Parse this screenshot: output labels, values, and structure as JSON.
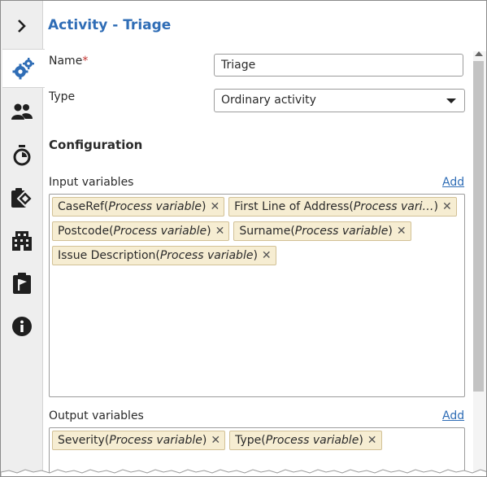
{
  "rail": {
    "items": [
      {
        "icon": "chevron-right-icon"
      },
      {
        "icon": "gears-icon",
        "active": true
      },
      {
        "icon": "people-icon"
      },
      {
        "icon": "stopwatch-icon"
      },
      {
        "icon": "clipboard-diamond-icon"
      },
      {
        "icon": "building-icon"
      },
      {
        "icon": "clipboard-flag-icon"
      },
      {
        "icon": "info-icon"
      }
    ]
  },
  "header": {
    "title_prefix": "Activity",
    "title_name": " - Triage"
  },
  "form": {
    "name_label": "Name",
    "required_mark": "*",
    "name_value": "Triage",
    "type_label": "Type",
    "type_value": "Ordinary activity"
  },
  "configuration": {
    "heading": "Configuration",
    "input": {
      "label": "Input variables",
      "add": "Add",
      "chips": [
        {
          "name": "CaseRef",
          "kind": "Process variable"
        },
        {
          "name": "First Line of Address",
          "kind": "Process vari…"
        },
        {
          "name": "Postcode",
          "kind": "Process variable"
        },
        {
          "name": "Surname",
          "kind": "Process variable"
        },
        {
          "name": "Issue Description",
          "kind": "Process variable"
        }
      ]
    },
    "output": {
      "label": "Output variables",
      "add": "Add",
      "chips": [
        {
          "name": "Severity",
          "kind": "Process variable"
        },
        {
          "name": "Type",
          "kind": "Process variable"
        }
      ]
    }
  },
  "colors": {
    "accent": "#2f6db6",
    "chip_bg": "#f6edd2",
    "chip_border": "#d2c196",
    "required": "#c2322f"
  }
}
